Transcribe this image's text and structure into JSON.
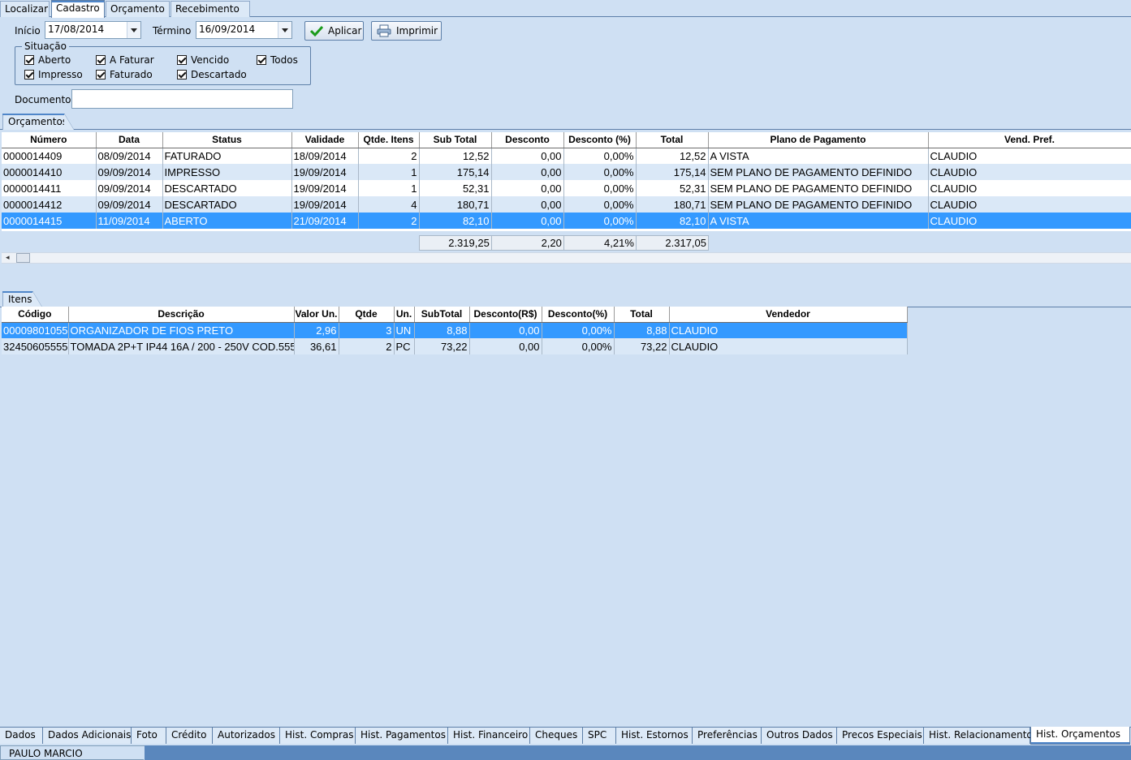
{
  "top_tabs": [
    "Localizar",
    "Cadastro",
    "Orçamento",
    "Recebimento"
  ],
  "filters": {
    "inicio_label": "Início",
    "inicio_value": "17/08/2014",
    "termino_label": "Término",
    "termino_value": "16/09/2014",
    "apply_label": "Aplicar",
    "print_label": "Imprimir",
    "situacao_label": "Situação",
    "checks": {
      "aberto": "Aberto",
      "a_faturar": "A Faturar",
      "vencido": "Vencido",
      "todos": "Todos",
      "impresso": "Impresso",
      "faturado": "Faturado",
      "descartado": "Descartado"
    },
    "documento_label": "Documento",
    "documento_value": ""
  },
  "orcamentos": {
    "tab": "Orçamentos",
    "headers": [
      "Número",
      "Data",
      "Status",
      "Validade",
      "Qtde. Itens",
      "Sub Total",
      "Desconto",
      "Desconto (%)",
      "Total",
      "Plano de Pagamento",
      "Vend. Pref."
    ],
    "rows": [
      [
        "0000014409",
        "08/09/2014",
        "FATURADO",
        "18/09/2014",
        "2",
        "12,52",
        "0,00",
        "0,00%",
        "12,52",
        "A VISTA",
        "CLAUDIO"
      ],
      [
        "0000014410",
        "09/09/2014",
        "IMPRESSO",
        "19/09/2014",
        "1",
        "175,14",
        "0,00",
        "0,00%",
        "175,14",
        "SEM PLANO DE PAGAMENTO DEFINIDO",
        "CLAUDIO"
      ],
      [
        "0000014411",
        "09/09/2014",
        "DESCARTADO",
        "19/09/2014",
        "1",
        "52,31",
        "0,00",
        "0,00%",
        "52,31",
        "SEM PLANO DE PAGAMENTO DEFINIDO",
        "CLAUDIO"
      ],
      [
        "0000014412",
        "09/09/2014",
        "DESCARTADO",
        "19/09/2014",
        "4",
        "180,71",
        "0,00",
        "0,00%",
        "180,71",
        "SEM PLANO DE PAGAMENTO DEFINIDO",
        "CLAUDIO"
      ],
      [
        "0000014415",
        "11/09/2014",
        "ABERTO",
        "21/09/2014",
        "2",
        "82,10",
        "0,00",
        "0,00%",
        "82,10",
        "A VISTA",
        "CLAUDIO"
      ]
    ],
    "totals": {
      "sub_total": "2.319,25",
      "desconto": "2,20",
      "desconto_pct": "4,21%",
      "total": "2.317,05"
    }
  },
  "itens": {
    "tab": "Itens",
    "headers": [
      "Código",
      "Descrição",
      "Valor Un.",
      "Qtde",
      "Un.",
      "SubTotal",
      "Desconto(R$)",
      "Desconto(%)",
      "Total",
      "Vendedor"
    ],
    "rows": [
      [
        "00009801055",
        "ORGANIZADOR DE FIOS PRETO",
        "2,96",
        "3",
        "UN",
        "8,88",
        "0,00",
        "0,00%",
        "8,88",
        "CLAUDIO"
      ],
      [
        "32450605555",
        "TOMADA 2P+T IP44 16A / 200 - 250V COD.555",
        "36,61",
        "2",
        "PC",
        "73,22",
        "0,00",
        "0,00%",
        "73,22",
        "CLAUDIO"
      ]
    ]
  },
  "bottom_tabs": [
    "Dados",
    "Dados Adicionais",
    "Foto",
    "Crédito",
    "Autorizados",
    "Hist. Compras",
    "Hist. Pagamentos",
    "Hist. Financeiro",
    "Cheques",
    "SPC",
    "Hist. Estornos",
    "Preferências",
    "Outros Dados",
    "Precos Especiais",
    "Hist. Relacionamento",
    "Hist. Orçamentos"
  ],
  "status_user": "PAULO MARCIO",
  "colors": {
    "selection": "#3399ff",
    "background": "#cfe0f3",
    "alt_row": "#dae8f7",
    "accent": "#4f86c9"
  }
}
